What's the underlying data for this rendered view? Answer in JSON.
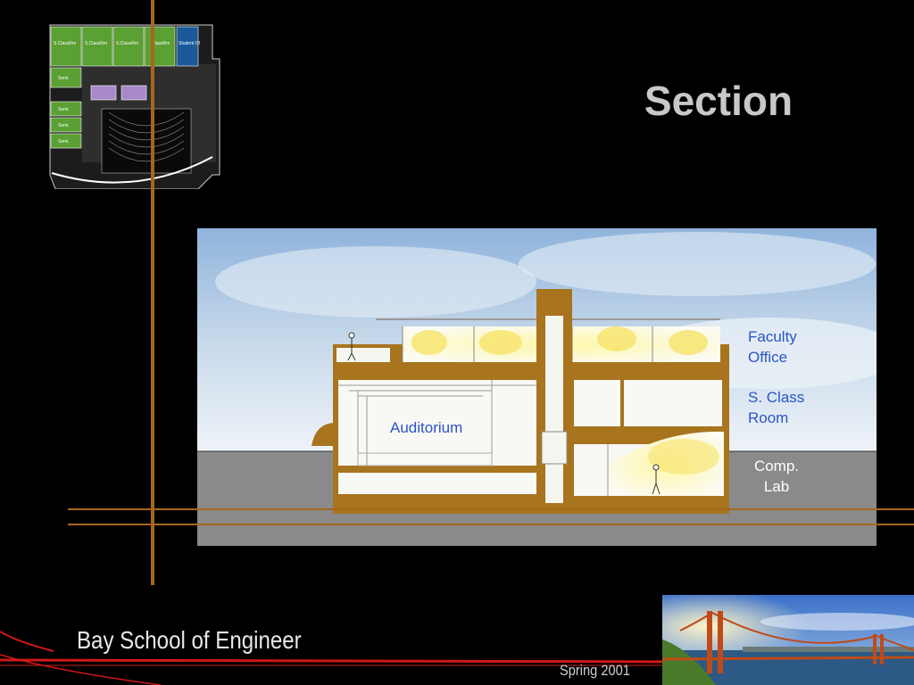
{
  "slide": {
    "title": "Section",
    "footer_title": "Bay School of Engineer",
    "footer_date": "Spring 2001"
  },
  "plan": {
    "rooms": [
      "S.ClassRm",
      "S.ClassRm",
      "S.ClassRm",
      "ClassRm"
    ],
    "student_office": "Student Of",
    "seminars": [
      "Semi.",
      "Semi.",
      "Semi.",
      "Semi."
    ]
  },
  "section_labels": {
    "faculty_office_line1": "Faculty",
    "faculty_office_line2": "Office",
    "class_room_line1": "S. Class",
    "class_room_line2": "Room",
    "comp_lab_line1": "Comp.",
    "comp_lab_line2": "Lab",
    "auditorium": "Auditorium"
  },
  "colors": {
    "accent_orange": "#a8661c",
    "structure_brown": "#a8741e",
    "label_blue": "#2a55c8",
    "plan_green": "#5aa032",
    "plan_blue": "#1a5a9a",
    "footer_red": "#d01818"
  }
}
